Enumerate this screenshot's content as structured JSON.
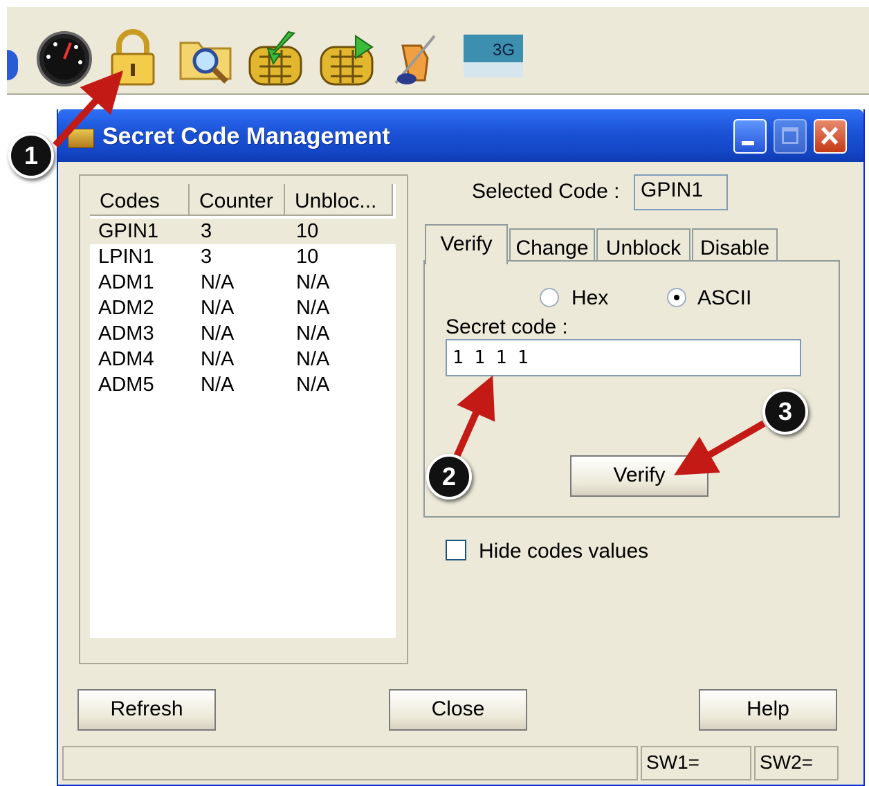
{
  "toolbar": {
    "icons": [
      "speed-gauge-icon",
      "padlock-icon",
      "folder-search-icon",
      "sim-card-import-icon",
      "sim-card-export-icon",
      "tools-icon",
      "3g-card-icon"
    ],
    "badge_3g": "3G"
  },
  "dialog": {
    "title": "Secret Code Management",
    "codes_list": {
      "columns": [
        "Codes",
        "Counter",
        "Unbloc..."
      ],
      "rows": [
        {
          "code": "GPIN1",
          "counter": "3",
          "unblock": "10"
        },
        {
          "code": "LPIN1",
          "counter": "3",
          "unblock": "10"
        },
        {
          "code": "ADM1",
          "counter": "N/A",
          "unblock": "N/A"
        },
        {
          "code": "ADM2",
          "counter": "N/A",
          "unblock": "N/A"
        },
        {
          "code": "ADM3",
          "counter": "N/A",
          "unblock": "N/A"
        },
        {
          "code": "ADM4",
          "counter": "N/A",
          "unblock": "N/A"
        },
        {
          "code": "ADM5",
          "counter": "N/A",
          "unblock": "N/A"
        }
      ]
    },
    "selected_code_label": "Selected Code :",
    "selected_code_value": "GPIN1",
    "tabs": [
      "Verify",
      "Change",
      "Unblock",
      "Disable"
    ],
    "radio_hex": "Hex",
    "radio_ascii": "ASCII",
    "secret_code_label": "Secret code :",
    "secret_code_value": "1 1 1 1",
    "verify_button": "Verify",
    "hide_codes_label": "Hide codes values",
    "refresh_button": "Refresh",
    "close_button": "Close",
    "help_button": "Help",
    "status_sw1": "SW1=",
    "status_sw2": "SW2="
  },
  "annotations": [
    "1",
    "2",
    "3"
  ],
  "colors": {
    "arrow": "#c41a16",
    "titlebar": "#1b52d6",
    "window_face": "#ece9d8"
  }
}
